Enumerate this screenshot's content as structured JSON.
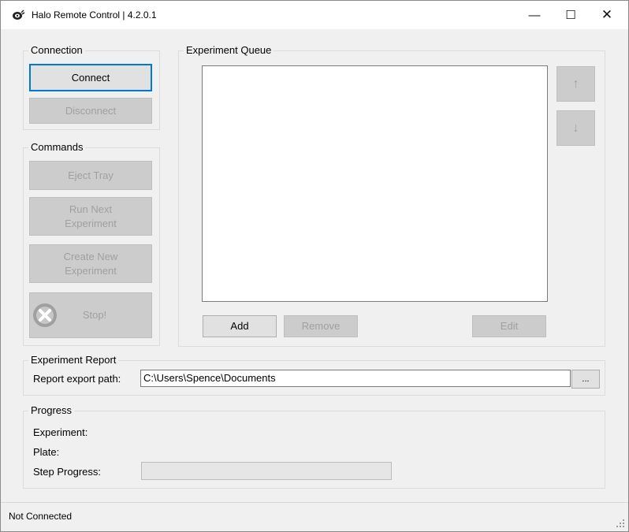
{
  "window": {
    "title": "Halo Remote Control | 4.2.0.1",
    "minimize_glyph": "—",
    "maximize_glyph": "☐",
    "close_glyph": "✕"
  },
  "connection": {
    "title": "Connection",
    "connect_label": "Connect",
    "disconnect_label": "Disconnect"
  },
  "commands": {
    "title": "Commands",
    "eject_label": "Eject Tray",
    "run_next_label": "Run Next Experiment",
    "create_new_label": "Create New Experiment",
    "stop_label": "Stop!"
  },
  "queue": {
    "title": "Experiment Queue",
    "items": [],
    "move_up_glyph": "↑",
    "move_down_glyph": "↓",
    "add_label": "Add",
    "remove_label": "Remove",
    "edit_label": "Edit"
  },
  "report": {
    "title": "Experiment Report",
    "path_label": "Report export path:",
    "path_value": "C:\\Users\\Spence\\Documents",
    "browse_label": "..."
  },
  "progress": {
    "title": "Progress",
    "experiment_label": "Experiment:",
    "experiment_value": "",
    "plate_label": "Plate:",
    "plate_value": "",
    "step_label": "Step Progress:",
    "step_value": 0
  },
  "status": {
    "text": "Not Connected"
  },
  "colors": {
    "focus_border": "#0078d7",
    "disabled_bg": "#cccccc",
    "disabled_text": "#a0a0a0",
    "window_bg": "#f0f0f0"
  },
  "icons": {
    "app": "halo-app-icon",
    "stop": "stop-x-icon",
    "grip": "resize-grip-icon"
  }
}
